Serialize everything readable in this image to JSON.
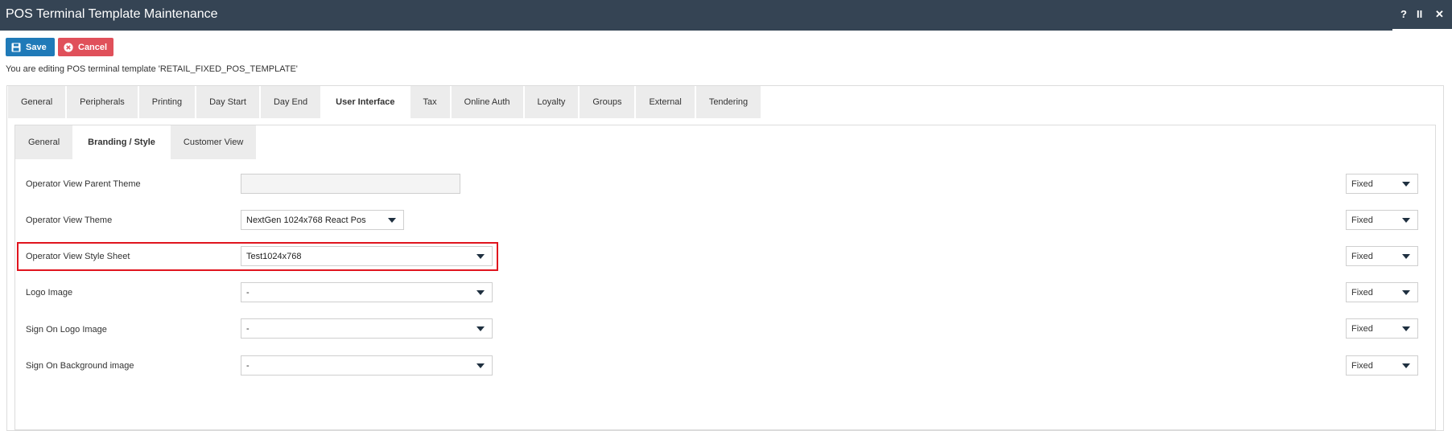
{
  "window": {
    "title": "POS Terminal Template Maintenance",
    "help": "?",
    "pause": "II",
    "close": "✕"
  },
  "toolbar": {
    "save_label": "Save",
    "cancel_label": "Cancel"
  },
  "info_text": "You are editing POS terminal template 'RETAIL_FIXED_POS_TEMPLATE'",
  "main_tabs": [
    {
      "label": "General"
    },
    {
      "label": "Peripherals"
    },
    {
      "label": "Printing"
    },
    {
      "label": "Day Start"
    },
    {
      "label": "Day End"
    },
    {
      "label": "User Interface",
      "active": true
    },
    {
      "label": "Tax"
    },
    {
      "label": "Online Auth"
    },
    {
      "label": "Loyalty"
    },
    {
      "label": "Groups"
    },
    {
      "label": "External"
    },
    {
      "label": "Tendering"
    }
  ],
  "sub_tabs": [
    {
      "label": "General"
    },
    {
      "label": "Branding / Style",
      "active": true
    },
    {
      "label": "Customer View"
    }
  ],
  "rows": [
    {
      "label": "Operator View Parent Theme",
      "value": "",
      "mode": "Fixed"
    },
    {
      "label": "Operator View Theme",
      "value": "NextGen 1024x768 React Pos",
      "mode": "Fixed"
    },
    {
      "label": "Operator View Style Sheet",
      "value": "Test1024x768",
      "mode": "Fixed"
    },
    {
      "label": "Logo Image",
      "value": "-",
      "mode": "Fixed"
    },
    {
      "label": "Sign On Logo Image",
      "value": "-",
      "mode": "Fixed"
    },
    {
      "label": "Sign On Background image",
      "value": "-",
      "mode": "Fixed"
    }
  ],
  "colors": {
    "titlebar": "#354454",
    "save": "#1f7ab8",
    "cancel": "#e0505a",
    "highlight": "#e0141e"
  }
}
